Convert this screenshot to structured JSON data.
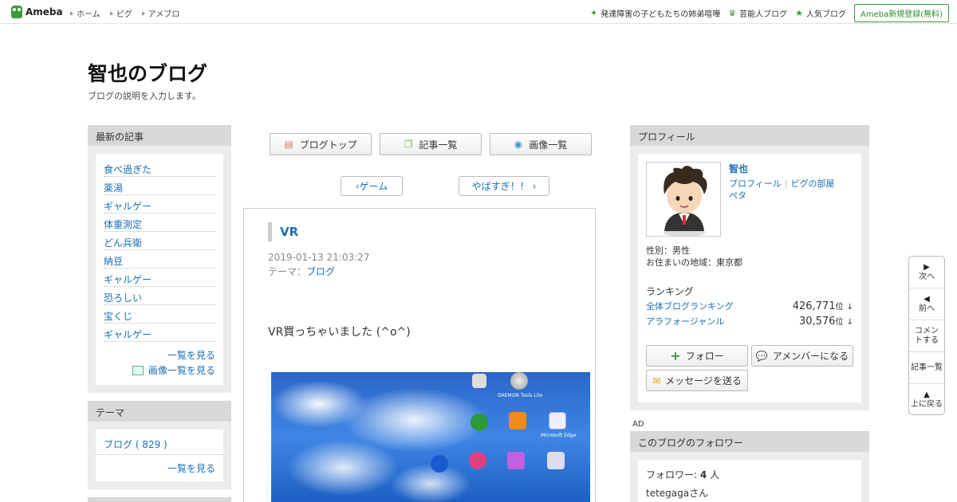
{
  "header": {
    "logo_text": "Ameba",
    "nav": [
      "ホーム",
      "ピグ",
      "アメブロ"
    ],
    "right_links": [
      {
        "icon": "sparkle-icon",
        "label": "発達障害の子どもたちの姉弟喧嘩"
      },
      {
        "icon": "crown-icon",
        "label": "芸能人ブログ"
      },
      {
        "icon": "star-icon",
        "label": "人気ブログ"
      }
    ],
    "register_label": "Ameba新規登録(無料)"
  },
  "blog": {
    "title": "智也のブログ",
    "description": "ブログの説明を入力します。"
  },
  "recent": {
    "heading": "最新の記事",
    "items": [
      "食べ過ぎた",
      "薬湯",
      "ギャルゲー",
      "体重測定",
      "どん兵衛",
      "納豆",
      "ギャルゲー",
      "恐ろしい",
      "宝くじ",
      "ギャルゲー"
    ],
    "more_label": "一覧を見る",
    "images_label": "画像一覧を見る"
  },
  "theme": {
    "heading": "テーマ",
    "item": "ブログ ( 829 )",
    "more_label": "一覧を見る"
  },
  "nav_buttons": {
    "top": "ブログトップ",
    "list": "記事一覧",
    "images": "画像一覧"
  },
  "pager": {
    "prev": "ゲーム",
    "next": "やばすぎ！！"
  },
  "entry": {
    "title": "VR",
    "date": "2019-01-13 21:03:27",
    "theme_label": "テーマ：",
    "theme_value": "ブログ",
    "body": "VR買っちゃいました (^o^)",
    "image_labels": [
      "DAEMON Tools Lite",
      "Microsoft Edge"
    ]
  },
  "profile": {
    "heading": "プロフィール",
    "name": "智也",
    "link_profile": "プロフィール",
    "link_room": "ピグの部屋",
    "link_peta": "ペタ",
    "gender": "性別：男性",
    "location": "お住まいの地域：東京都",
    "ranking_heading": "ランキング",
    "ranks": [
      {
        "label": "全体ブログランキング",
        "value": "426,771",
        "unit": "位",
        "trend": "↓"
      },
      {
        "label": "アラフォージャンル",
        "value": "30,576",
        "unit": "位",
        "trend": "↓"
      }
    ],
    "follow_label": "フォロー",
    "amember_label": "アメンバーになる",
    "message_label": "メッセージを送る"
  },
  "ad_label": "AD",
  "followers": {
    "heading": "このブログのフォロワー",
    "count_label": "フォロワー:",
    "count": "4",
    "count_unit": "人",
    "first": "tetegagaさん"
  },
  "float_nav": {
    "next": "次へ",
    "prev": "前へ",
    "comment": "コメントする",
    "list": "記事一覧",
    "top": "上に戻る"
  },
  "colors": {
    "link": "#1a6fb5",
    "ameba_green": "#3b9b3b",
    "sidebar_bg": "#ececec",
    "sidebar_header": "#d8d8d8"
  }
}
